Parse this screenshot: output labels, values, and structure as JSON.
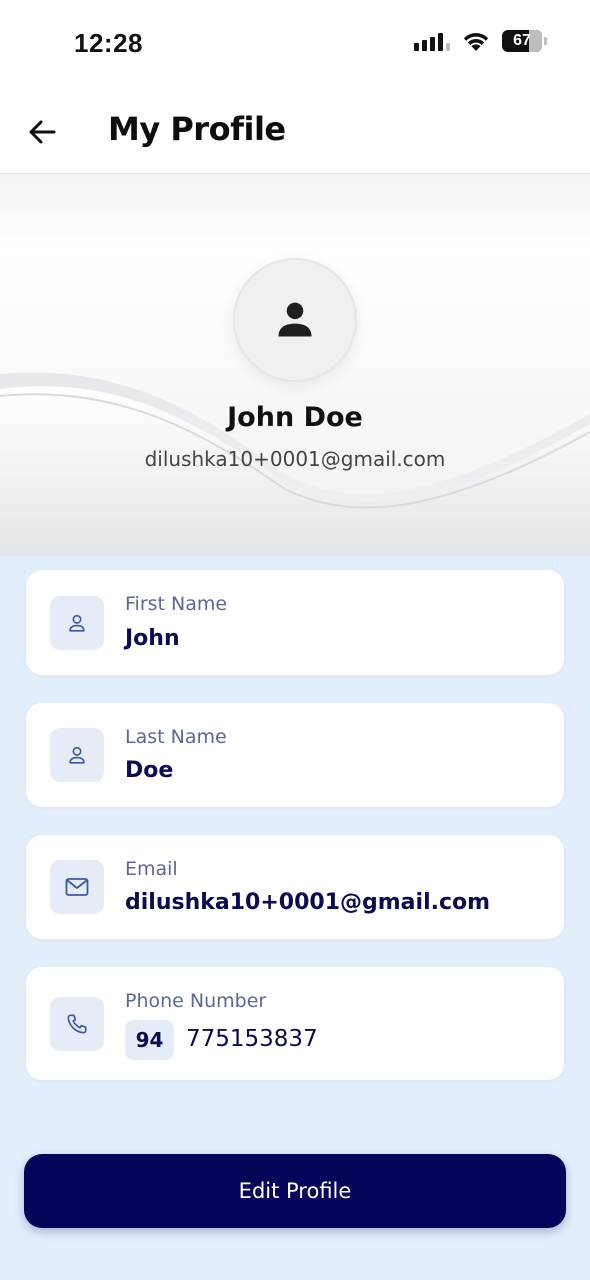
{
  "status_bar": {
    "time": "12:28",
    "battery": "67"
  },
  "header": {
    "title": "My Profile"
  },
  "profile": {
    "name": "John Doe",
    "email": "dilushka10+0001@gmail.com"
  },
  "fields": {
    "first_name": {
      "label": "First Name",
      "value": "John",
      "icon": "person-icon"
    },
    "last_name": {
      "label": "Last Name",
      "value": "Doe",
      "icon": "person-icon"
    },
    "email": {
      "label": "Email",
      "value": "dilushka10+0001@gmail.com",
      "icon": "mail-icon"
    },
    "phone": {
      "label": "Phone Number",
      "country_code": "94",
      "value": "775153837",
      "icon": "phone-icon"
    }
  },
  "actions": {
    "edit_label": "Edit Profile"
  },
  "colors": {
    "background": "#e3eefc",
    "primary": "#05055a",
    "label": "#5d6794",
    "icon_bg": "#e6ecf7"
  }
}
